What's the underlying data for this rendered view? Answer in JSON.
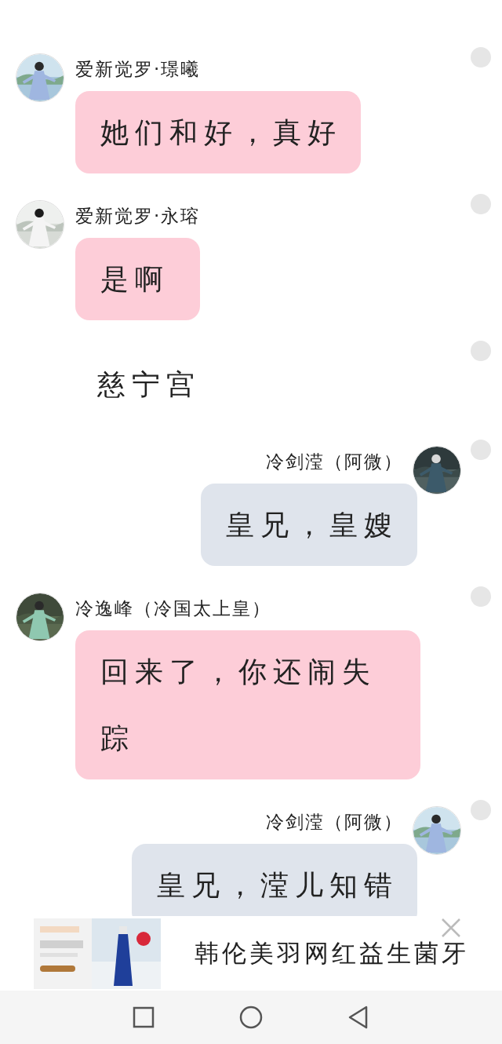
{
  "messages": [
    {
      "kind": "left",
      "name": "爱新觉罗·璟曦",
      "text": "她们和好，真好",
      "selected": false
    },
    {
      "kind": "left",
      "name": "爱新觉罗·永瑢",
      "text": "是啊",
      "selected": false
    },
    {
      "kind": "narration",
      "text": "慈宁宫",
      "selected": false
    },
    {
      "kind": "right",
      "name": "冷剑滢（阿微）",
      "text": "皇兄，皇嫂",
      "selected": false
    },
    {
      "kind": "left",
      "name": "冷逸峰（冷国太上皇）",
      "text": "回来了，你还闹失踪",
      "selected": false
    },
    {
      "kind": "right",
      "name": "冷剑滢（阿微）",
      "text": "皇兄，滢儿知错",
      "selected": false
    }
  ],
  "ad": {
    "title": "韩伦美羽网红益生菌牙"
  },
  "nav_bar": {
    "buttons": [
      {
        "kind": "recent"
      },
      {
        "kind": "home"
      },
      {
        "kind": "back"
      }
    ]
  }
}
